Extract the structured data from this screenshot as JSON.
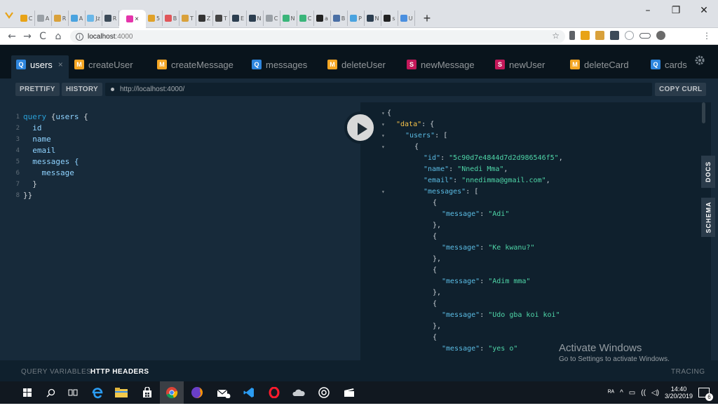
{
  "browser": {
    "tabs": [
      {
        "label": "C",
        "color": "#e8a317"
      },
      {
        "label": "A",
        "color": "#9aa0a6"
      },
      {
        "label": "R",
        "color": "#d9a13b"
      },
      {
        "label": "A",
        "color": "#4aa3df"
      },
      {
        "label": "Jz",
        "color": "#6ab7e8"
      },
      {
        "label": "R",
        "color": "#3c4a58"
      },
      {
        "label": "5",
        "color": "#e0a128"
      },
      {
        "label": "B",
        "color": "#e0565a"
      },
      {
        "label": "T",
        "color": "#d9a13b"
      },
      {
        "label": "Z",
        "color": "#333333"
      },
      {
        "label": "T",
        "color": "#444444"
      },
      {
        "label": "E",
        "color": "#2c3e50"
      },
      {
        "label": "N",
        "color": "#2c3e50"
      },
      {
        "label": "C",
        "color": "#9aa0a6"
      },
      {
        "label": "N",
        "color": "#3ab57a"
      },
      {
        "label": "C",
        "color": "#3ab57a"
      },
      {
        "label": "a",
        "color": "#222222"
      },
      {
        "label": "B",
        "color": "#4a6fa5"
      },
      {
        "label": "P",
        "color": "#4aa3df"
      },
      {
        "label": "N",
        "color": "#2c3e50"
      },
      {
        "label": "s",
        "color": "#222222"
      },
      {
        "label": "U",
        "color": "#4a8fdf"
      }
    ],
    "active_tab_close": "×",
    "new_tab": "+",
    "window_controls": {
      "minimize": "–",
      "maximize": "❐",
      "close": "✕"
    },
    "nav": {
      "back": "←",
      "forward": "→",
      "reload": "C",
      "home": "⌂"
    },
    "address": {
      "host": "localhost",
      "port": ":4000",
      "star": "☆"
    },
    "menu": "⋮"
  },
  "playground": {
    "tabs": [
      {
        "type": "Q",
        "label": "users",
        "close": "×"
      },
      {
        "type": "M",
        "label": "createUser"
      },
      {
        "type": "M",
        "label": "createMessage"
      },
      {
        "type": "Q",
        "label": "messages"
      },
      {
        "type": "M",
        "label": "deleteUser"
      },
      {
        "type": "S",
        "label": "newMessage"
      },
      {
        "type": "S",
        "label": "newUser"
      },
      {
        "type": "M",
        "label": "deleteCard"
      },
      {
        "type": "Q",
        "label": "cards"
      }
    ],
    "prettify": "PRETTIFY",
    "history": "HISTORY",
    "endpoint": "http://localhost:4000/",
    "copy_curl": "COPY CURL",
    "query_lines": [
      {
        "n": "1",
        "text": "query {users {"
      },
      {
        "n": "2",
        "text": "  id"
      },
      {
        "n": "3",
        "text": "  name"
      },
      {
        "n": "4",
        "text": "  email"
      },
      {
        "n": "5",
        "text": "  messages {"
      },
      {
        "n": "6",
        "text": "    message"
      },
      {
        "n": "7",
        "text": "  }"
      },
      {
        "n": "8",
        "text": "}}"
      }
    ],
    "result_lines": [
      {
        "indent": 0,
        "text": "{",
        "arrow": true
      },
      {
        "indent": 1,
        "key": "\"data\"",
        "rest": ": {",
        "data": true,
        "arrow": true
      },
      {
        "indent": 2,
        "key": "\"users\"",
        "rest": ": [",
        "arrow": true
      },
      {
        "indent": 3,
        "text": "{",
        "arrow": true
      },
      {
        "indent": 4,
        "key": "\"id\"",
        "rest": ": ",
        "str": "\"5c90d7e4844d7d2d986546f5\"",
        "tail": ","
      },
      {
        "indent": 4,
        "key": "\"name\"",
        "rest": ": ",
        "str": "\"Nnedi Mma\"",
        "tail": ","
      },
      {
        "indent": 4,
        "key": "\"email\"",
        "rest": ": ",
        "str": "\"nnedimma@gmail.com\"",
        "tail": ","
      },
      {
        "indent": 4,
        "key": "\"messages\"",
        "rest": ": [",
        "arrow": true
      },
      {
        "indent": 5,
        "text": "{"
      },
      {
        "indent": 6,
        "key": "\"message\"",
        "rest": ": ",
        "str": "\"Adi\""
      },
      {
        "indent": 5,
        "text": "},"
      },
      {
        "indent": 5,
        "text": "{"
      },
      {
        "indent": 6,
        "key": "\"message\"",
        "rest": ": ",
        "str": "\"Ke kwanu?\""
      },
      {
        "indent": 5,
        "text": "},"
      },
      {
        "indent": 5,
        "text": "{"
      },
      {
        "indent": 6,
        "key": "\"message\"",
        "rest": ": ",
        "str": "\"Adim mma\""
      },
      {
        "indent": 5,
        "text": "},"
      },
      {
        "indent": 5,
        "text": "{"
      },
      {
        "indent": 6,
        "key": "\"message\"",
        "rest": ": ",
        "str": "\"Udo gba koi koi\""
      },
      {
        "indent": 5,
        "text": "},"
      },
      {
        "indent": 5,
        "text": "{"
      },
      {
        "indent": 6,
        "key": "\"message\"",
        "rest": ": ",
        "str": "\"yes o\""
      }
    ],
    "docs": "DOCS",
    "schema": "SCHEMA",
    "query_variables": "QUERY VARIABLES",
    "http_headers": "HTTP HEADERS",
    "tracing": "TRACING",
    "colors": {
      "query": "#2e86de",
      "mutation": "#f5a623",
      "subscription": "#c4185a"
    }
  },
  "watermark": {
    "title": "Activate Windows",
    "subtitle": "Go to Settings to activate Windows."
  },
  "taskbar": {
    "clock_time": "14:40",
    "clock_date": "3/20/2019",
    "notification_count": "6",
    "tray_text": "ᴿᴬ"
  }
}
